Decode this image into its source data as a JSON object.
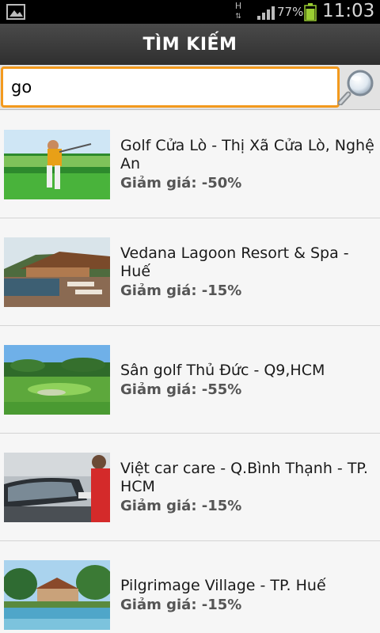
{
  "status_bar": {
    "network_type": "H",
    "battery_percent": "77%",
    "time": "11:03"
  },
  "header": {
    "title": "TÌM KIẾM"
  },
  "search": {
    "value": "go",
    "icon": "magnifier-icon"
  },
  "results": [
    {
      "title": "Golf Cửa Lò - Thị Xã Cửa Lò, Nghệ An",
      "discount": "Giảm giá: -50%",
      "image": "golfer-photo"
    },
    {
      "title": "Vedana Lagoon Resort & Spa - Huế",
      "discount": "Giảm giá: -15%",
      "image": "resort-deck-photo"
    },
    {
      "title": "Sân golf Thủ Đức - Q9,HCM",
      "discount": "Giảm giá: -55%",
      "image": "golf-course-photo"
    },
    {
      "title": "Việt car care - Q.Bình Thạnh - TP. HCM",
      "discount": "Giảm giá: -15%",
      "image": "car-wash-photo"
    },
    {
      "title": "Pilgrimage Village - TP. Huế",
      "discount": "Giảm giá: -15%",
      "image": "village-pool-photo"
    }
  ]
}
